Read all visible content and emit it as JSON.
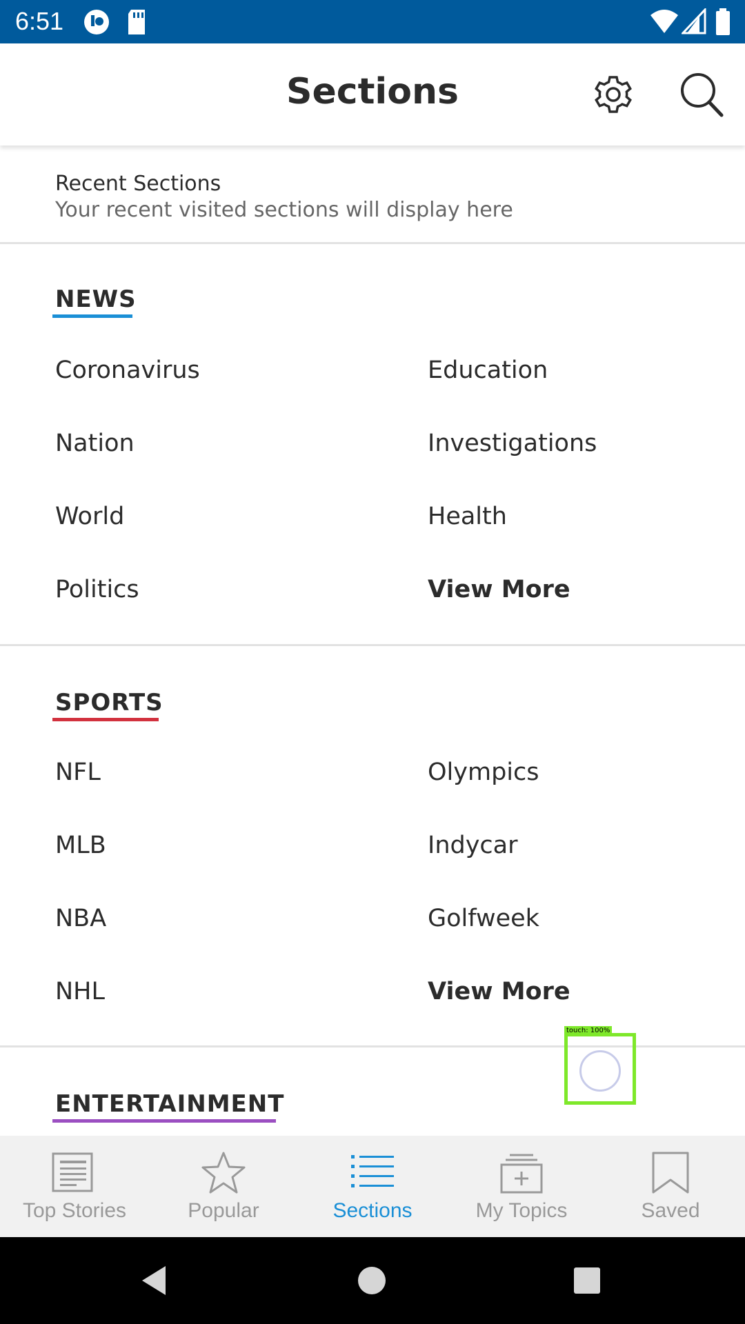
{
  "status_bar": {
    "time": "6:51"
  },
  "header": {
    "title": "Sections"
  },
  "recent": {
    "title": "Recent Sections",
    "subtitle": "Your recent visited sections will display here"
  },
  "sections": [
    {
      "name": "NEWS",
      "accent": "#1a8fd6",
      "items_left": [
        "Coronavirus",
        "Nation",
        "World",
        "Politics"
      ],
      "items_right": [
        "Education",
        "Investigations",
        "Health",
        "View More"
      ]
    },
    {
      "name": "SPORTS",
      "accent": "#d2313e",
      "items_left": [
        "NFL",
        "MLB",
        "NBA",
        "NHL"
      ],
      "items_right": [
        "Olympics",
        "Indycar",
        "Golfweek",
        "View More"
      ]
    },
    {
      "name": "ENTERTAINMENT",
      "accent": "#9b4fc1"
    }
  ],
  "touch_overlay": {
    "label": "touch: 100%"
  },
  "bottom_nav": [
    {
      "label": "Top Stories",
      "icon": "newspaper-icon"
    },
    {
      "label": "Popular",
      "icon": "star-icon"
    },
    {
      "label": "Sections",
      "icon": "list-icon",
      "active": true
    },
    {
      "label": "My Topics",
      "icon": "add-topic-icon"
    },
    {
      "label": "Saved",
      "icon": "bookmark-icon"
    }
  ],
  "colors": {
    "status_bar": "#005a9c",
    "active_tab": "#1a8fd6",
    "inactive_tab": "#999999"
  }
}
